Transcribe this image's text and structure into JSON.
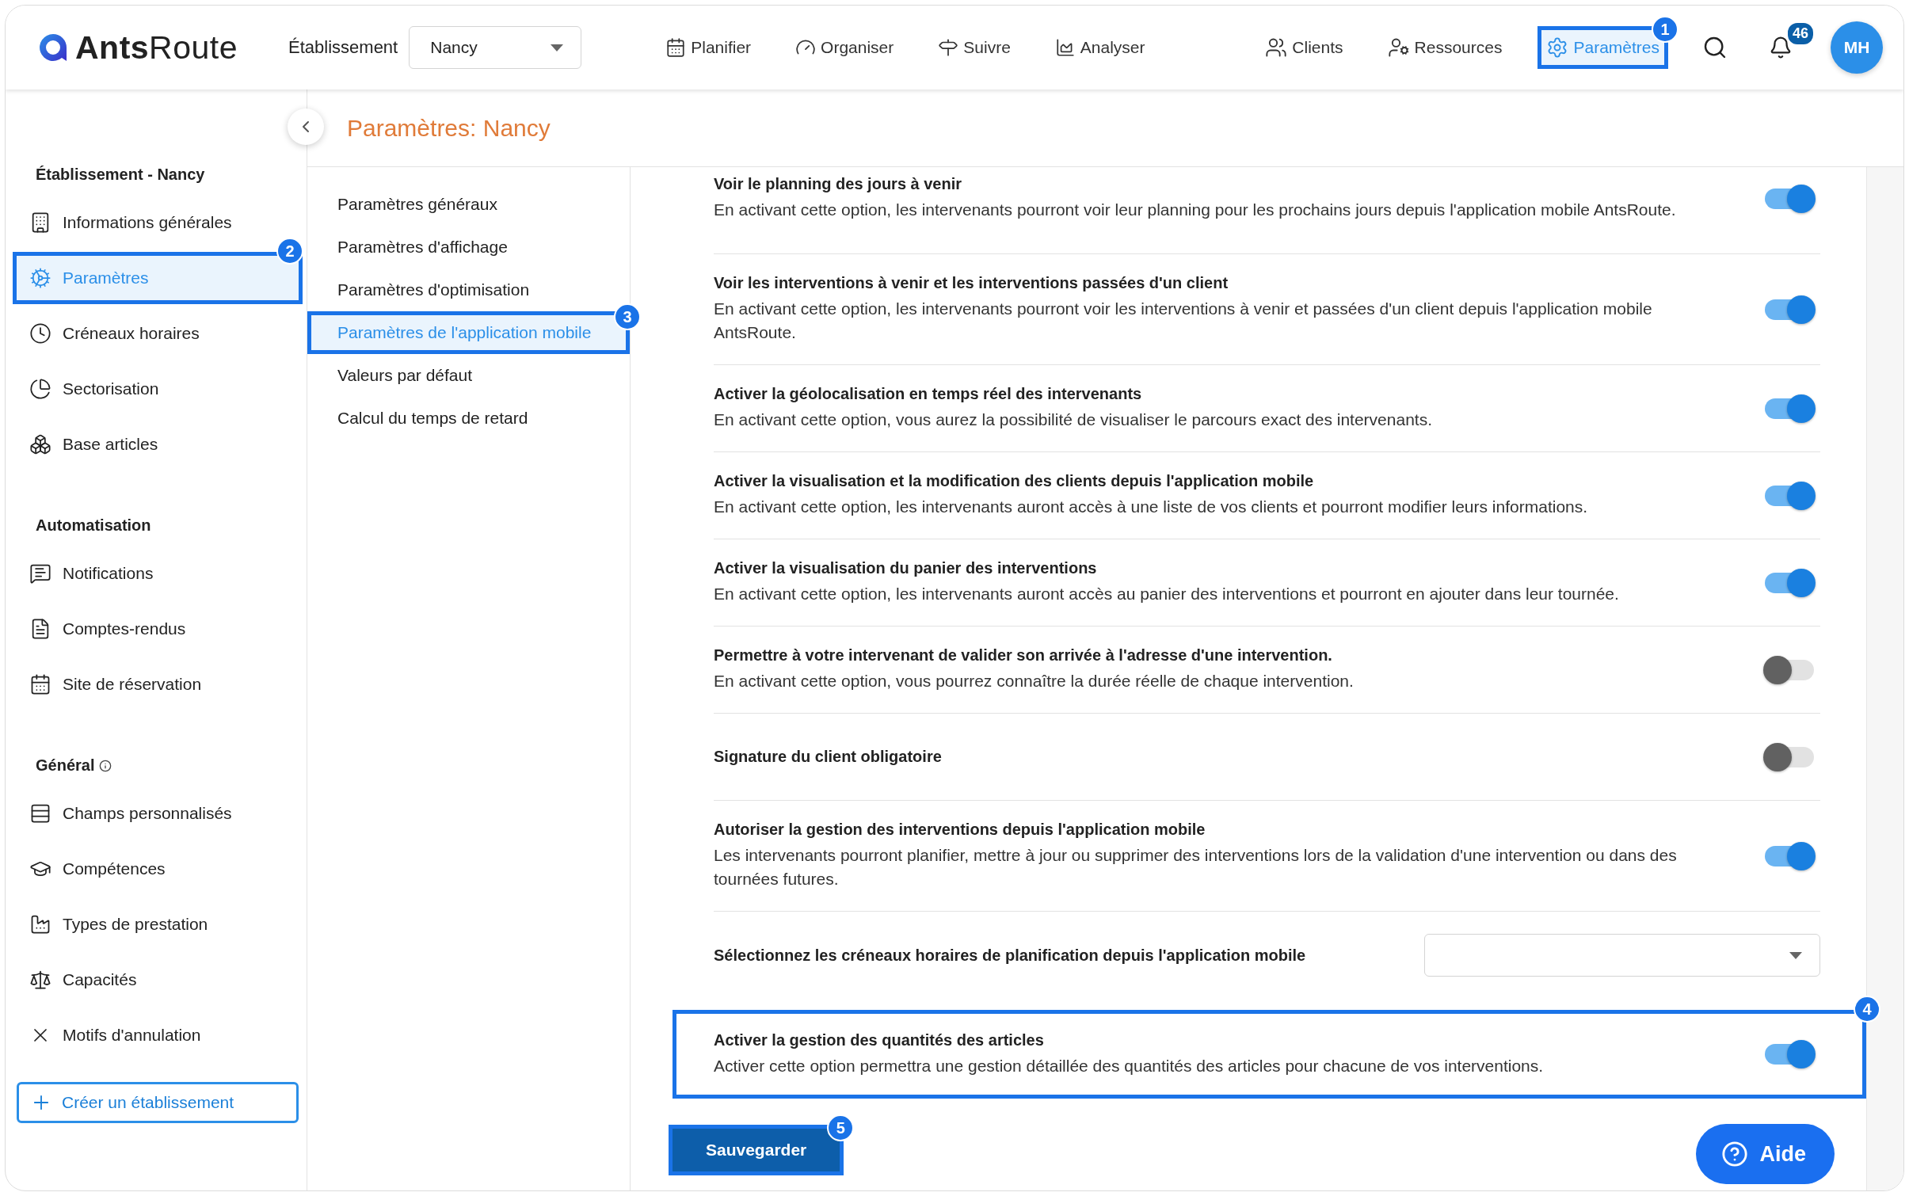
{
  "topbar": {
    "logo": "**Ants**Route",
    "establishment_label": "Établissement",
    "establishment_select": {
      "value": "Nancy"
    },
    "nav": [
      {
        "label": "Planifier",
        "selected": false
      },
      {
        "label": "Organiser",
        "selected": false
      },
      {
        "label": "Suivre",
        "selected": false
      },
      {
        "label": "Analyser",
        "selected": false
      }
    ],
    "right_nav": [
      {
        "label": "Clients",
        "selected": false
      },
      {
        "label": "Ressources",
        "selected": false
      },
      {
        "label": "Paramètres",
        "selected": true,
        "callout": "1"
      }
    ],
    "notifications": {
      "count": "46"
    },
    "avatar": "MH"
  },
  "sidebar": {
    "sections": [
      {
        "title": "Établissement - Nancy",
        "items": [
          {
            "label": "Informations générales",
            "selected": false
          },
          {
            "label": "Paramètres",
            "selected": true,
            "callout": "2"
          },
          {
            "label": "Créneaux horaires",
            "selected": false
          },
          {
            "label": "Sectorisation",
            "selected": false
          },
          {
            "label": "Base articles",
            "selected": false
          }
        ]
      },
      {
        "title": "Automatisation",
        "items": [
          {
            "label": "Notifications",
            "selected": false
          },
          {
            "label": "Comptes-rendus",
            "selected": false
          },
          {
            "label": "Site de réservation",
            "selected": false
          }
        ]
      },
      {
        "title": "Général",
        "info": true,
        "items": [
          {
            "label": "Champs personnalisés",
            "selected": false
          },
          {
            "label": "Compétences",
            "selected": false
          },
          {
            "label": "Types de prestation",
            "selected": false
          },
          {
            "label": "Capacités",
            "selected": false
          },
          {
            "label": "Motifs d'annulation",
            "selected": false
          }
        ]
      }
    ],
    "create_button": "Créer un établissement"
  },
  "page_title": "Paramètres: Nancy",
  "submenu": [
    {
      "label": "Paramètres généraux",
      "selected": false
    },
    {
      "label": "Paramètres d'affichage",
      "selected": false
    },
    {
      "label": "Paramètres d'optimisation",
      "selected": false
    },
    {
      "label": "Paramètres de l'application mobile",
      "selected": true,
      "callout": "3"
    },
    {
      "label": "Valeurs par défaut",
      "selected": false
    },
    {
      "label": "Calcul du temps de retard",
      "selected": false
    }
  ],
  "settings": [
    {
      "kind": "toggle",
      "title": "Voir le planning des jours à venir",
      "description": "En activant cette option, les intervenants pourront voir leur planning pour les prochains jours depuis l'application mobile AntsRoute.",
      "on": true
    },
    {
      "kind": "toggle",
      "title": "Voir les interventions à venir et les interventions passées d'un client",
      "description": "En activant cette option, les intervenants pourront voir les interventions à venir et passées d'un client depuis l'application mobile AntsRoute.",
      "on": true
    },
    {
      "kind": "toggle",
      "title": "Activer la géolocalisation en temps réel des intervenants",
      "description": "En activant cette option, vous aurez la possibilité de visualiser le parcours exact des intervenants.",
      "on": true
    },
    {
      "kind": "toggle",
      "title": "Activer la visualisation et la modification des clients depuis l'application mobile",
      "description": "En activant cette option, les intervenants auront accès à une liste de vos clients et pourront modifier leurs informations.",
      "on": true
    },
    {
      "kind": "toggle",
      "title": "Activer la visualisation du panier des interventions",
      "description": "En activant cette option, les intervenants auront accès au panier des interventions et pourront en ajouter dans leur tournée.",
      "on": true
    },
    {
      "kind": "toggle",
      "title": "Permettre à votre intervenant de valider son arrivée à l'adresse d'une intervention.",
      "description": "En activant cette option, vous pourrez connaître la durée réelle de chaque intervention.",
      "on": false
    },
    {
      "kind": "toggle",
      "title": "Signature du client obligatoire",
      "on": false
    },
    {
      "kind": "toggle",
      "title": "Autoriser la gestion des interventions depuis l'application mobile",
      "description": "Les intervenants pourront planifier, mettre à jour ou supprimer des interventions lors de la validation d'une intervention ou dans des tournées futures.",
      "on": true
    },
    {
      "kind": "select",
      "title": "Sélectionnez les créneaux horaires de planification depuis l'application mobile"
    },
    {
      "kind": "toggle",
      "title": "Activer la gestion des quantités des articles",
      "description": "Activer cette option permettra une gestion détaillée des quantités des articles pour chacune de vos interventions.",
      "on": true,
      "callout": "4"
    }
  ],
  "save_button": {
    "label": "Sauvegarder",
    "callout": "5"
  },
  "help_button": "Aide"
}
